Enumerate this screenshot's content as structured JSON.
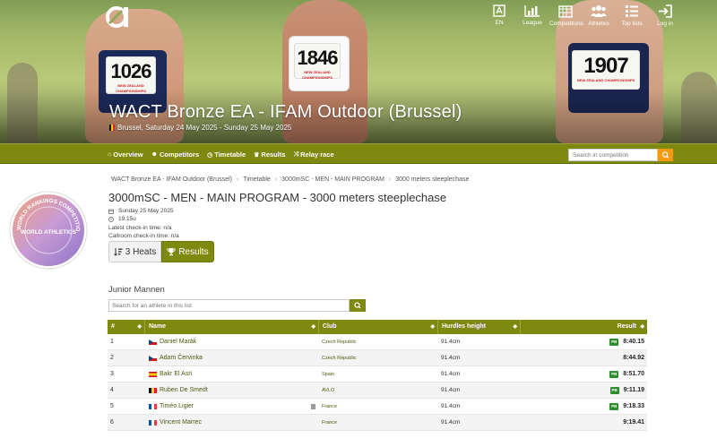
{
  "topnav": [
    {
      "label": "EN",
      "icon": "language-icon"
    },
    {
      "label": "League",
      "icon": "bar-chart-icon"
    },
    {
      "label": "Competitions",
      "icon": "calendar-icon"
    },
    {
      "label": "Athletes",
      "icon": "users-icon"
    },
    {
      "label": "Top lists",
      "icon": "list-icon"
    },
    {
      "label": "Log in",
      "icon": "login-icon"
    }
  ],
  "hero": {
    "title": "WACT Bronze EA - IFAM Outdoor (Brussel)",
    "subtitle": "Brussel, Saturday 24 May 2025 - Sunday 25 May 2025",
    "bibs": [
      "1026",
      "1846",
      "1907"
    ],
    "bib_caption": "NEW ZEALAND CHAMPIONSHIPS"
  },
  "navbar": {
    "links": [
      {
        "label": "Overview",
        "icon": "home-icon"
      },
      {
        "label": "Competitors",
        "icon": "users-icon"
      },
      {
        "label": "Timetable",
        "icon": "clock-icon"
      },
      {
        "label": "Results",
        "icon": "trophy-icon"
      },
      {
        "label": "Relay race",
        "icon": "shuffle-icon"
      }
    ],
    "search_placeholder": "Search in competition"
  },
  "breadcrumb": [
    "WACT Bronze EA - IFAM Outdoor (Brussel)",
    "Timetable",
    "3000mSC - MEN - MAIN PROGRAM",
    "3000 meters steeplechase"
  ],
  "event": {
    "title": "3000mSC - MEN - MAIN PROGRAM - 3000 meters steeplechase",
    "date": "Sunday 25 May 2025",
    "time": "19:15u",
    "checkin": "Latest check-in time: n/a",
    "callroom": "Callroom check-in time: n/a"
  },
  "badge": {
    "top_text": "WORLD RANKINGS COMPETITION",
    "center_text": "WORLD ATHLETICS"
  },
  "tabs": {
    "heats_label": "3 Heats",
    "results_label": "Results"
  },
  "group": {
    "title": "Junior Mannen",
    "filter_placeholder": "Search for an athlete in this list"
  },
  "table": {
    "headers": [
      "#",
      "Name",
      "Club",
      "Hurdles height",
      "Result"
    ],
    "rows": [
      {
        "pos": "1",
        "name": "Daniel Marák",
        "flag": "cz",
        "club": "Czech Republic",
        "hurdles": "91.4cm",
        "pb": "PB",
        "result": "8:40.15"
      },
      {
        "pos": "2",
        "name": "Adam Červinka",
        "flag": "cz",
        "club": "Czech Republic",
        "hurdles": "91.4cm",
        "pb": "",
        "result": "8:44.92"
      },
      {
        "pos": "3",
        "name": "Bakr El Asri",
        "flag": "es",
        "club": "Spain",
        "hurdles": "91.4cm",
        "pb": "PB",
        "result": "8:51.70"
      },
      {
        "pos": "4",
        "name": "Ruben De Smedt",
        "flag": "be",
        "club": "AVLO",
        "hurdles": "91.4cm",
        "pb": "PB",
        "result": "9:11.19"
      },
      {
        "pos": "5",
        "name": "Timéo Ligier",
        "flag": "fr",
        "club": "France",
        "hurdles": "91.4cm",
        "pb": "PB",
        "result": "9:18.33"
      },
      {
        "pos": "6",
        "name": "Vincent Marrec",
        "flag": "fr",
        "club": "France",
        "hurdles": "91.4cm",
        "pb": "",
        "result": "9:19.41"
      }
    ]
  },
  "colors": {
    "accent": "#7e8a0f",
    "search_button": "#f39a11",
    "pb_badge": "#2e8b2e",
    "link": "#4a5a0c"
  }
}
